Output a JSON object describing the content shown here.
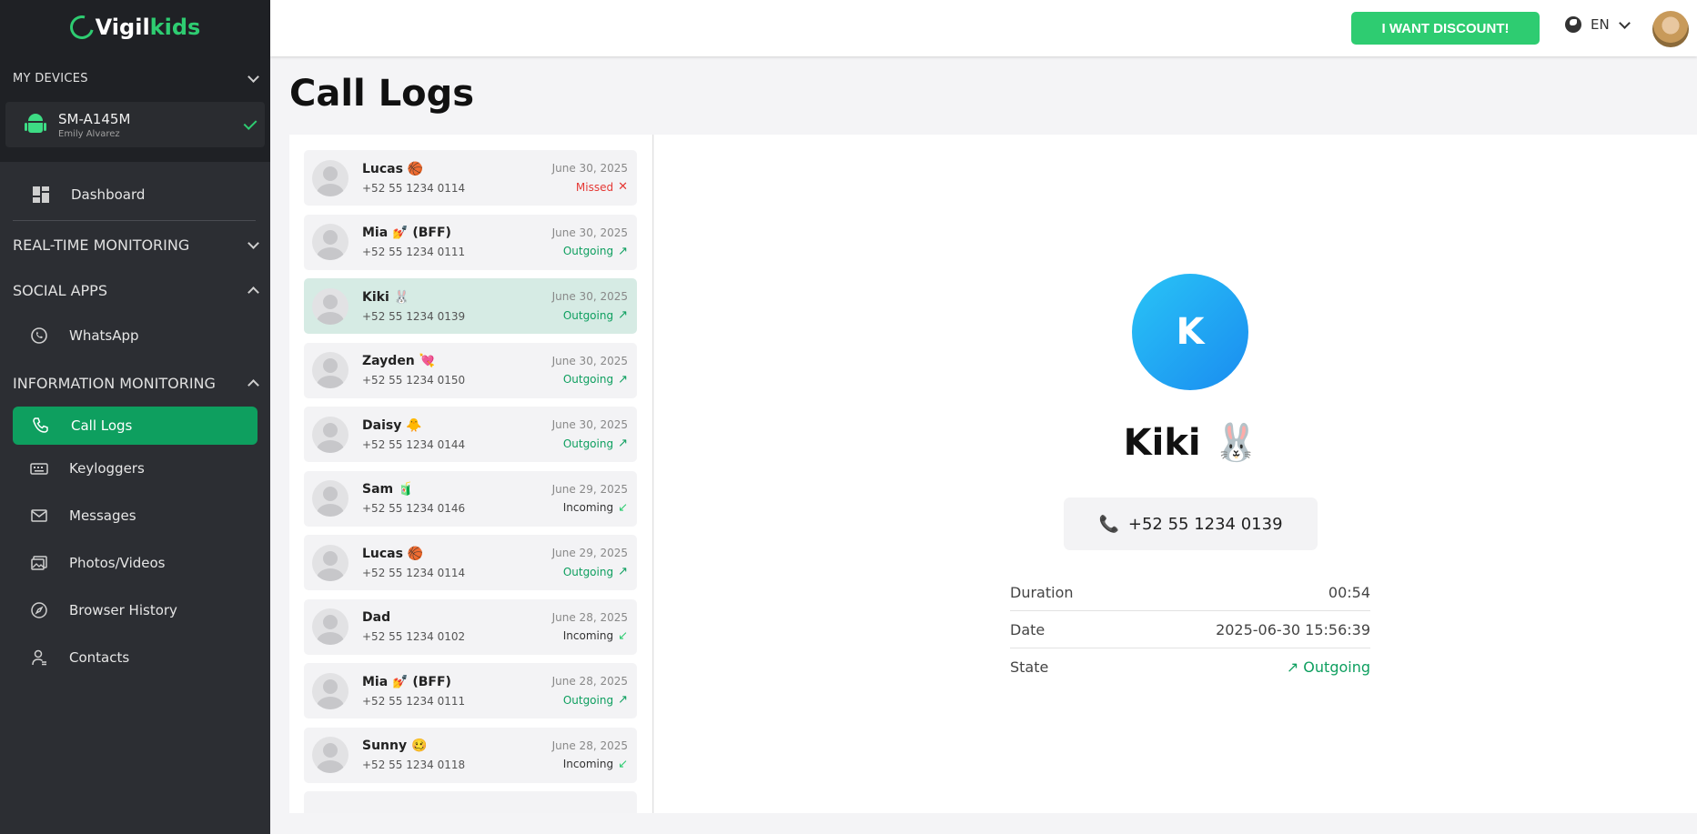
{
  "brand": {
    "name_prefix": "Vigil",
    "name_suffix": "kids"
  },
  "sidebar": {
    "devices_header": "MY DEVICES",
    "device": {
      "name": "SM-A145M",
      "owner": "Emily Alvarez"
    },
    "dashboard": "Dashboard",
    "sections": {
      "realtime": "REAL-TIME MONITORING",
      "social": "SOCIAL APPS",
      "info": "INFORMATION MONITORING"
    },
    "social_items": [
      "WhatsApp"
    ],
    "info_items": [
      "Call Logs",
      "Keyloggers",
      "Messages",
      "Photos/Videos",
      "Browser History",
      "Contacts"
    ]
  },
  "topbar": {
    "discount_label": "I WANT DISCOUNT!",
    "language": "EN"
  },
  "page": {
    "title": "Call Logs"
  },
  "calls": [
    {
      "name": "Lucas 🏀",
      "phone": "+52 55 1234 0114",
      "date": "June 30, 2025",
      "state": "Missed"
    },
    {
      "name": "Mia 💅 (BFF)",
      "phone": "+52 55 1234 0111",
      "date": "June 30, 2025",
      "state": "Outgoing"
    },
    {
      "name": "Kiki 🐰",
      "phone": "+52 55 1234 0139",
      "date": "June 30, 2025",
      "state": "Outgoing"
    },
    {
      "name": "Zayden 💘",
      "phone": "+52 55 1234 0150",
      "date": "June 30, 2025",
      "state": "Outgoing"
    },
    {
      "name": "Daisy 🐥",
      "phone": "+52 55 1234 0144",
      "date": "June 30, 2025",
      "state": "Outgoing"
    },
    {
      "name": "Sam 🧃",
      "phone": "+52 55 1234 0146",
      "date": "June 29, 2025",
      "state": "Incoming"
    },
    {
      "name": "Lucas 🏀",
      "phone": "+52 55 1234 0114",
      "date": "June 29, 2025",
      "state": "Outgoing"
    },
    {
      "name": "Dad",
      "phone": "+52 55 1234 0102",
      "date": "June 28, 2025",
      "state": "Incoming"
    },
    {
      "name": "Mia 💅 (BFF)",
      "phone": "+52 55 1234 0111",
      "date": "June 28, 2025",
      "state": "Outgoing"
    },
    {
      "name": "Sunny 🥴",
      "phone": "+52 55 1234 0118",
      "date": "June 28, 2025",
      "state": "Incoming"
    }
  ],
  "selected_index": 2,
  "detail": {
    "initial": "K",
    "name": "Kiki 🐰",
    "phone": "+52 55 1234 0139",
    "fields": [
      {
        "label": "Duration",
        "value": "00:54"
      },
      {
        "label": "Date",
        "value": "2025-06-30 15:56:39"
      },
      {
        "label": "State",
        "value": "Outgoing"
      }
    ]
  },
  "colors": {
    "accent": "#0e9f5f",
    "discount": "#2ecc71",
    "missed": "#e53935",
    "sidebar": "#2c2e33"
  }
}
